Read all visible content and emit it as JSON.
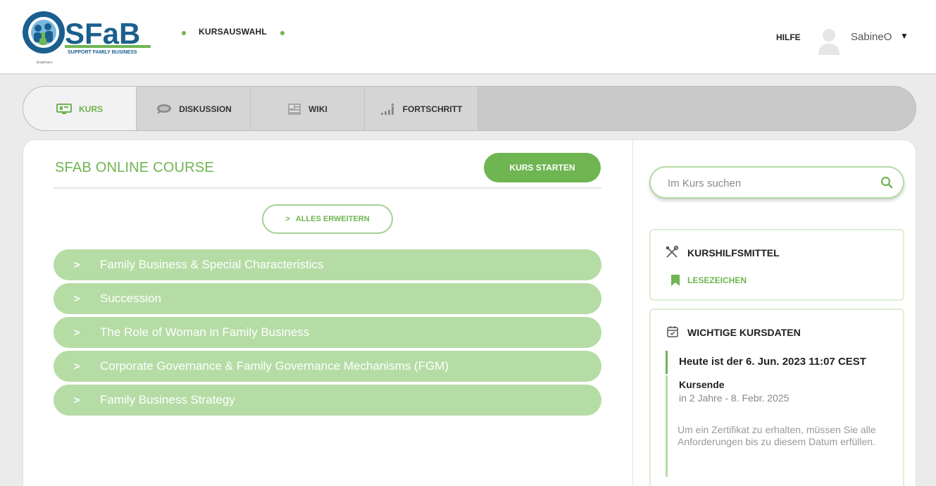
{
  "header": {
    "logo": {
      "text": "SFaB",
      "tagline": "SUPPORT FAMILY BUSINESS",
      "erasmus": "Erasmus+"
    },
    "nav_label": "KURSAUSWAHL",
    "help_label": "HILFE",
    "username": "SabineO"
  },
  "tabs": [
    {
      "label": "KURS",
      "icon": "course-screen-icon",
      "active": true
    },
    {
      "label": "DISKUSSION",
      "icon": "chat-bubbles-icon",
      "active": false
    },
    {
      "label": "WIKI",
      "icon": "wiki-page-icon",
      "active": false
    },
    {
      "label": "FORTSCHRITT",
      "icon": "progress-bars-icon",
      "active": false
    }
  ],
  "course": {
    "title": "SFAB ONLINE COURSE",
    "start_button": "KURS STARTEN",
    "expand_button": "ALLES ERWEITERN",
    "sections": [
      "Family Business & Special Characteristics",
      "Succession",
      "The Role of Woman in Family Business",
      "Corporate Governance & Family Governance Mechanisms (FGM)",
      "Family Business Strategy"
    ]
  },
  "sidebar": {
    "search_placeholder": "Im Kurs suchen",
    "tools_title": "KURSHILFSMITTEL",
    "bookmarks_label": "LESEZEICHEN",
    "dates_title": "WICHTIGE KURSDATEN",
    "today": "Heute ist der 6. Jun. 2023 11:07 CEST",
    "course_end_label": "Kursende",
    "course_end_date": "in 2 Jahre - 8. Febr. 2025",
    "certificate_note": "Um ein Zertifikat zu erhalten, müssen Sie alle Anforderungen bis zu diesem Datum erfüllen."
  },
  "colors": {
    "accent_green": "#6fb552",
    "section_green": "#b5dca5",
    "logo_blue": "#1b5f8e"
  }
}
